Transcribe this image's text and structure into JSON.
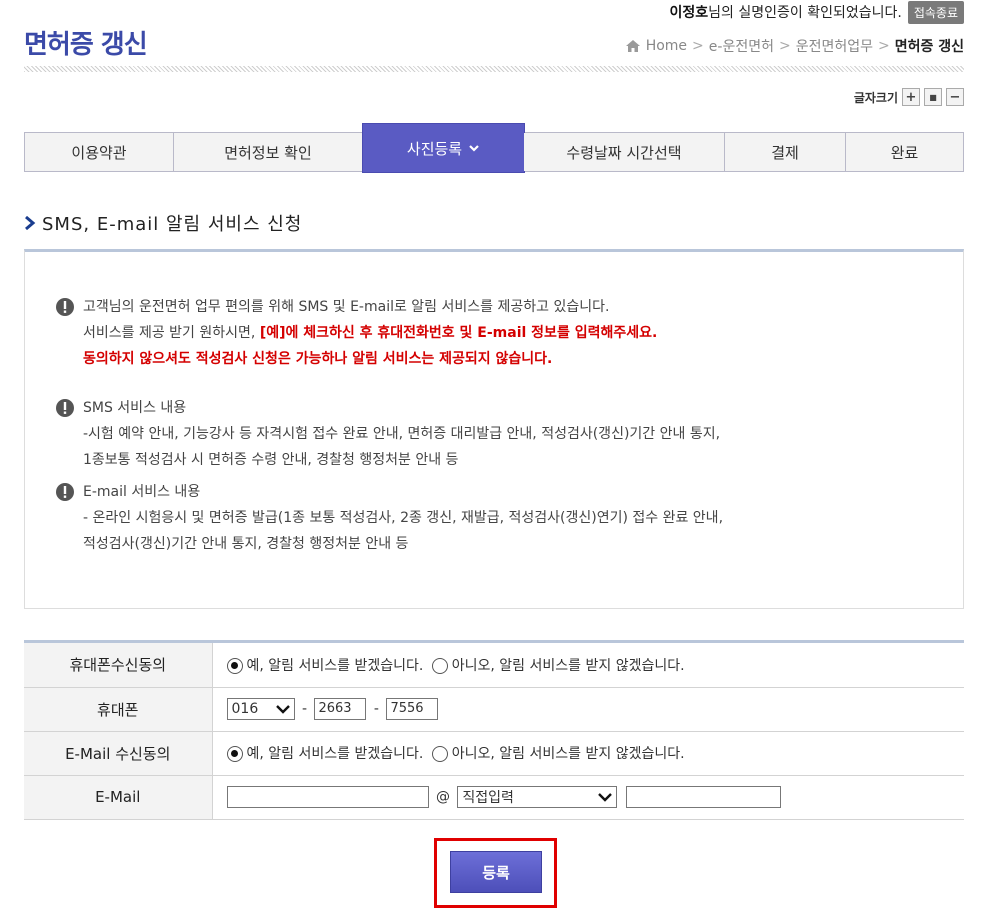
{
  "header": {
    "user_name": "이정호",
    "user_msg": "님의 실명인증이 확인되었습니다.",
    "logout_label": "접속종료",
    "title": "면허증 갱신",
    "breadcrumb": [
      "Home",
      "e-운전면허",
      "운전면허업무",
      "면허증 갱신"
    ],
    "font_size_label": "글자크기"
  },
  "steps": [
    {
      "label": "이용약관"
    },
    {
      "label": "면허정보 확인"
    },
    {
      "label": "사진등록"
    },
    {
      "label": "수령날짜 시간선택"
    },
    {
      "label": "결제"
    },
    {
      "label": "완료"
    }
  ],
  "section": {
    "title": "SMS, E-mail 알림 서비스 신청"
  },
  "notice": {
    "intro_line1": "고객님의 운전면허 업무 편의를 위해 SMS 및 E-mail로 알림 서비스를 제공하고 있습니다.",
    "intro_line2_prefix": "서비스를 제공 받기 원하시면, ",
    "intro_line2_red": "[예]에 체크하신 후 휴대전화번호 및 E-mail 정보를 입력해주세요.",
    "intro_line3_red": "동의하지 않으셔도 적성검사 신청은 가능하나 알림 서비스는 제공되지 않습니다.",
    "sms_title": "SMS 서비스 내용",
    "sms_line1": "-시험 예약 안내, 기능강사 등 자격시험 접수 완료 안내, 면허증 대리발급 안내, 적성검사(갱신)기간 안내 통지,",
    "sms_line2": "1종보통 적성검사 시 면허증 수령 안내, 경찰청 행정처분 안내 등",
    "email_title": "E-mail 서비스 내용",
    "email_line1": "- 온라인 시험응시 및 면허증 발급(1종 보통 적성검사, 2종 갱신, 재발급, 적성검사(갱신)연기) 접수 완료 안내,",
    "email_line2": "적성검사(갱신)기간 안내 통지, 경찰청 행정처분 안내 등"
  },
  "form": {
    "phone_consent_label": "휴대폰수신동의",
    "phone_label": "휴대폰",
    "email_consent_label": "E-Mail 수신동의",
    "email_label": "E-Mail",
    "yes_option": "예, 알림 서비스를 받겠습니다.",
    "no_option": "아니오, 알림 서비스를 받지 않겠습니다.",
    "phone_prefix": "016",
    "phone_mid": "2663",
    "phone_last": "7556",
    "dash": "-",
    "at": "@",
    "email_user": "",
    "email_domain_select": "직접입력",
    "email_domain": ""
  },
  "register_label": "등록",
  "colors": {
    "accent": "#5a5bc3",
    "title": "#3b4aa8",
    "warning": "#d40000",
    "highlight_box": "#e00000"
  }
}
